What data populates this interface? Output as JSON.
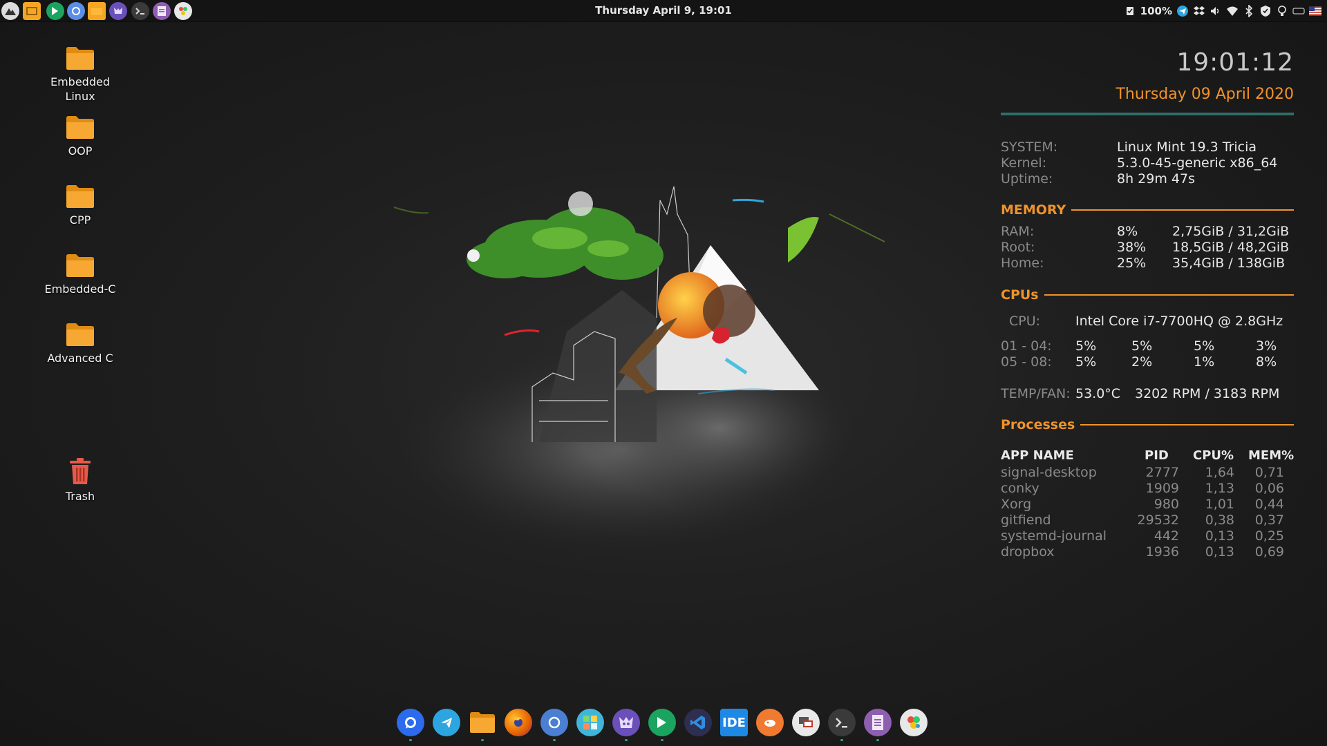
{
  "top_panel": {
    "clock": "Thursday April  9, 19:01",
    "battery": "100%",
    "launchers": [
      {
        "icon": "menu-icon"
      },
      {
        "icon": "file-manager-icon"
      },
      {
        "icon": "evernote-icon"
      },
      {
        "icon": "chromium-icon"
      },
      {
        "icon": "folder-icon"
      },
      {
        "icon": "gitfiend-icon"
      },
      {
        "icon": "terminal-icon"
      },
      {
        "icon": "text-editor-icon"
      },
      {
        "icon": "color-picker-icon"
      }
    ],
    "tray": [
      "usb-icon",
      "telegram-icon",
      "dropbox-icon",
      "volume-icon",
      "wifi-icon",
      "bluetooth-icon",
      "shield-icon",
      "lightbulb-icon",
      "keyboard-icon",
      "flag-us-icon"
    ]
  },
  "desktop_icons": [
    {
      "label": "Embedded\nLinux",
      "icon": "folder-icon"
    },
    {
      "label": "OOP",
      "icon": "folder-icon"
    },
    {
      "label": "CPP",
      "icon": "folder-icon"
    },
    {
      "label": "Embedded-C",
      "icon": "folder-icon"
    },
    {
      "label": "Advanced C",
      "icon": "folder-icon"
    },
    {
      "label": "Trash",
      "icon": "trash-icon"
    }
  ],
  "conky": {
    "time": "19:01:12",
    "date": "Thursday 09 April 2020",
    "system": [
      {
        "label": "SYSTEM:",
        "value": "Linux Mint 19.3 Tricia"
      },
      {
        "label": "Kernel:",
        "value": "5.3.0-45-generic  x86_64"
      },
      {
        "label": "Uptime:",
        "value": "8h 29m 47s"
      }
    ],
    "memory": {
      "title": "MEMORY",
      "rows": [
        {
          "label": "RAM:",
          "percent": "8%",
          "value": "2,75GiB / 31,2GiB"
        },
        {
          "label": "Root:",
          "percent": "38%",
          "value": "18,5GiB / 48,2GiB"
        },
        {
          "label": "Home:",
          "percent": "25%",
          "value": "35,4GiB / 138GiB"
        }
      ]
    },
    "cpus": {
      "title": "CPUs",
      "cpu_label": "CPU:",
      "cpu_model": "Intel Core i7-7700HQ @ 2.8GHz",
      "rows": [
        {
          "label": "01 - 04:",
          "values": [
            "5%",
            "5%",
            "5%",
            "3%"
          ]
        },
        {
          "label": "05 - 08:",
          "values": [
            "5%",
            "2%",
            "1%",
            "8%"
          ]
        }
      ],
      "temp_label": "TEMP/FAN:",
      "temp_value": "53.0°C",
      "fan_value": "3202 RPM / 3183 RPM"
    },
    "processes": {
      "title": "Processes",
      "headers": [
        "APP NAME",
        "PID",
        "CPU%",
        "MEM%"
      ],
      "rows": [
        [
          "signal-desktop",
          "2777",
          "1,64",
          "0,71"
        ],
        [
          "conky",
          "1909",
          "1,13",
          "0,06"
        ],
        [
          "Xorg",
          "980",
          "1,01",
          "0,44"
        ],
        [
          "gitfiend",
          "29532",
          "0,38",
          "0,37"
        ],
        [
          "systemd-journal",
          "442",
          "0,13",
          "0,25"
        ],
        [
          "dropbox",
          "1936",
          "0,13",
          "0,69"
        ]
      ]
    }
  },
  "dock": {
    "items": [
      {
        "icon": "signal-icon",
        "color": "#2c6bed"
      },
      {
        "icon": "telegram-icon",
        "color": "#2ca5e0"
      },
      {
        "icon": "files-icon",
        "color": "#f5a623"
      },
      {
        "icon": "firefox-icon",
        "color": "#e66000"
      },
      {
        "icon": "chromium-icon",
        "color": "#4a7fd4"
      },
      {
        "icon": "calculator-icon",
        "color": "#3fb5d9"
      },
      {
        "icon": "gitfiend-icon",
        "color": "#6b4fbb"
      },
      {
        "icon": "evernote-icon",
        "color": "#1ba360"
      },
      {
        "icon": "vscode-icon",
        "color": "#2b5aa8"
      },
      {
        "icon": "ide-icon",
        "label": "IDE",
        "color": "#1e88e5"
      },
      {
        "icon": "postman-icon",
        "color": "#ef7a30"
      },
      {
        "icon": "remote-desktop-icon",
        "color": "#e9e9e9"
      },
      {
        "icon": "terminal-icon",
        "color": "#3a3a3a"
      },
      {
        "icon": "text-editor-icon",
        "color": "#8e5fb0"
      },
      {
        "icon": "color-picker-icon",
        "color": "#e8e8e8"
      }
    ]
  },
  "colors": {
    "accent": "#f0932b",
    "rule": "#2f6e66",
    "folder": "#f7a833",
    "trash": "#e8594a"
  }
}
